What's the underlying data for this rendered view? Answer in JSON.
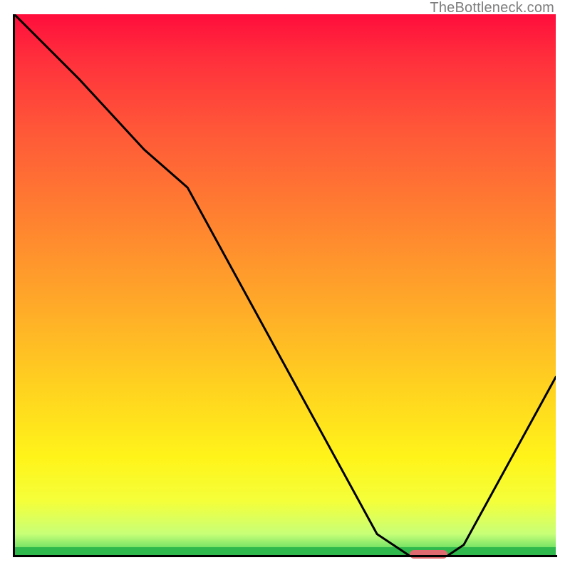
{
  "attribution": "TheBottleneck.com",
  "colors": {
    "gradient_top": "#ff0d3c",
    "gradient_bottom": "#46d15a",
    "bottom_band": "#2fb94c",
    "curve": "#000000",
    "axes": "#000000",
    "marker": "#e06a70",
    "attribution_text": "#7e7e7e"
  },
  "chart_data": {
    "type": "line",
    "title": "",
    "xlabel": "",
    "ylabel": "",
    "xlim": [
      0,
      100
    ],
    "ylim": [
      0,
      100
    ],
    "grid": false,
    "legend": false,
    "series": [
      {
        "name": "bottleneck-curve",
        "x": [
          0,
          12,
          24,
          32,
          67,
          73,
          80,
          83,
          100
        ],
        "values": [
          100,
          88,
          75,
          68,
          4,
          0,
          0,
          2,
          33
        ]
      }
    ],
    "marker": {
      "x_start": 73,
      "x_end": 80,
      "y": 0,
      "label": ""
    }
  }
}
